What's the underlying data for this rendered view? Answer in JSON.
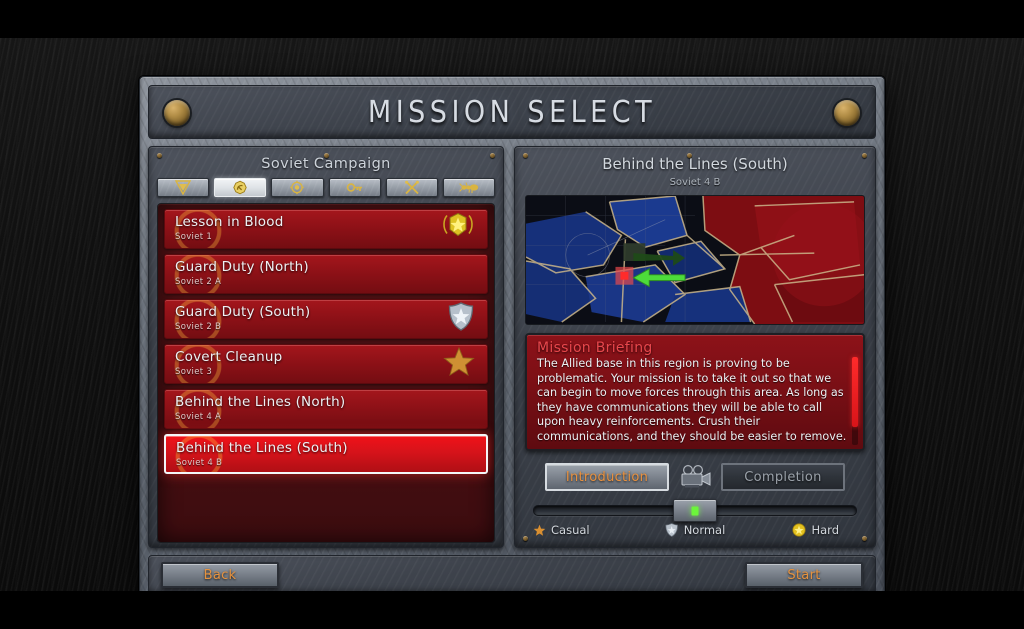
{
  "window": {
    "title": "MISSION SELECT"
  },
  "left_panel": {
    "heading": "Soviet Campaign",
    "tabs": [
      {
        "name": "allied",
        "icon": "allied-shield-icon",
        "selected": false
      },
      {
        "name": "soviet",
        "icon": "soviet-emblem-icon",
        "selected": true
      },
      {
        "name": "yuri",
        "icon": "yuri-eye-icon",
        "selected": false
      },
      {
        "name": "bonus",
        "icon": "key-icon",
        "selected": false
      },
      {
        "name": "coop",
        "icon": "crossed-tools-icon",
        "selected": false
      },
      {
        "name": "ant",
        "icon": "ant-icon",
        "selected": false
      }
    ],
    "missions": [
      {
        "name": "Lesson in Blood",
        "code": "Soviet 1",
        "badge": "gold-medal",
        "selected": false
      },
      {
        "name": "Guard Duty (North)",
        "code": "Soviet 2 A",
        "badge": "none",
        "selected": false
      },
      {
        "name": "Guard Duty (South)",
        "code": "Soviet 2 B",
        "badge": "silver-shield",
        "selected": false
      },
      {
        "name": "Covert Cleanup",
        "code": "Soviet 3",
        "badge": "bronze-star",
        "selected": false
      },
      {
        "name": "Behind the Lines (North)",
        "code": "Soviet 4 A",
        "badge": "none",
        "selected": false
      },
      {
        "name": "Behind the Lines (South)",
        "code": "Soviet 4 B",
        "badge": "none",
        "selected": true
      }
    ]
  },
  "right_panel": {
    "mission_title": "Behind the Lines (South)",
    "mission_code": "Soviet 4 B",
    "briefing_title": "Mission Briefing",
    "briefing_text": "The Allied base in this region is proving to be problematic. Your mission is to take it out so that we can begin to move forces through this area. As long as they have communications they will be able to call upon heavy reinforcements. Crush their communications, and they should be easier to remove.",
    "video_buttons": [
      {
        "label": "Introduction",
        "active": true
      },
      {
        "label": "Completion",
        "active": false
      }
    ],
    "camera_icon": "film-camera-icon",
    "difficulty": {
      "selected": "Normal",
      "options": [
        {
          "label": "Casual",
          "icon": "bronze-star-icon"
        },
        {
          "label": "Normal",
          "icon": "silver-shield-icon"
        },
        {
          "label": "Hard",
          "icon": "gold-medal-icon"
        }
      ]
    }
  },
  "footer": {
    "back_label": "Back",
    "start_label": "Start"
  },
  "colors": {
    "accent_orange": "#e5923f",
    "soviet_red": "#a4161c",
    "selected_red": "#f01219",
    "briefing_title": "#e8474c",
    "slider_green": "#6cf53a",
    "metal_light": "#9aa1aa",
    "text_light": "#d7dce3"
  }
}
